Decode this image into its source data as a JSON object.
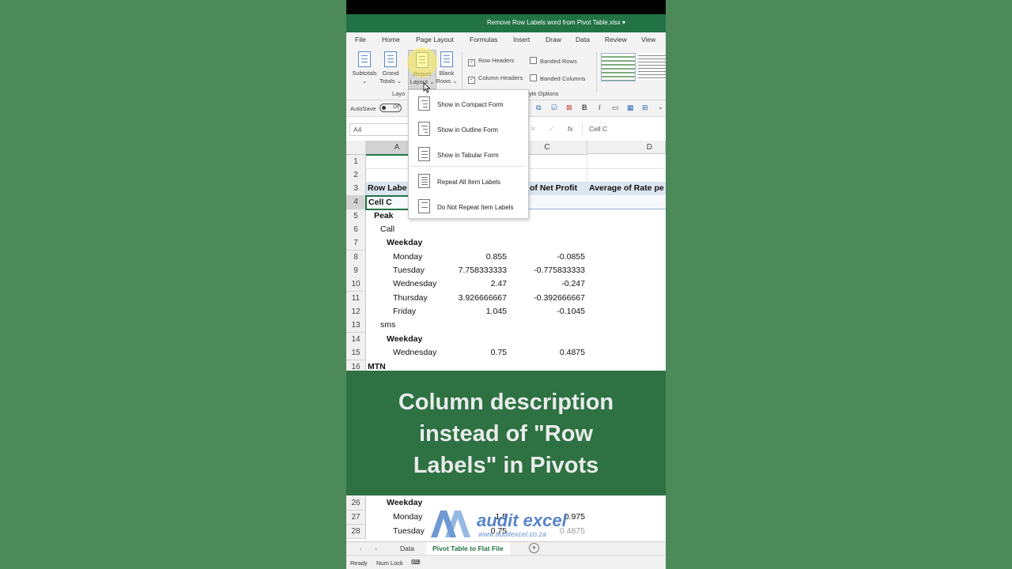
{
  "window": {
    "title": "Remove Row Labels word from Pivot Table.xlsx"
  },
  "menu": [
    "File",
    "Home",
    "Page Layout",
    "Formulas",
    "Insert",
    "Draw",
    "Data",
    "Review",
    "View"
  ],
  "ribbon": {
    "subtotals": "Subtotals",
    "grand_totals": [
      "Grand",
      "Totals"
    ],
    "report_layout": [
      "Report",
      "Layout"
    ],
    "blank_rows": [
      "Blank",
      "Rows"
    ],
    "row_headers": "Row Headers",
    "banded_rows": "Banded Rows",
    "column_headers": "Column Headers",
    "banded_columns": "Banded Columns",
    "group_layout": "Layo",
    "group_style_options": "yle Options"
  },
  "qat": {
    "autosave": "AutoSave",
    "toggle": "Off",
    "bold": "B",
    "italic": "I"
  },
  "formula_bar": {
    "name_box": "A4",
    "fx": "fx",
    "value": "Cell C"
  },
  "columns": [
    "A",
    "C",
    "D"
  ],
  "rows": [
    "1",
    "2",
    "3",
    "4",
    "5",
    "6",
    "7",
    "8",
    "9",
    "10",
    "11",
    "12",
    "13",
    "14",
    "15",
    "16"
  ],
  "cells": {
    "r3a": "Row Labe",
    "r3c": "of Net Profit",
    "r3d": "Average of Rate pe",
    "r4a": "Cell C",
    "r5a": "Peak",
    "r6a": "Call",
    "r7a": "Weekday",
    "r8a": "Monday",
    "r8b": "0.855",
    "r8c": "-0.0855",
    "r9a": "Tuesday",
    "r9b": "7.758333333",
    "r9c": "-0.775833333",
    "r10a": "Wednesday",
    "r10b": "2.47",
    "r10c": "-0.247",
    "r11a": "Thursday",
    "r11b": "3.926666667",
    "r11c": "-0.392666667",
    "r12a": "Friday",
    "r12b": "1.045",
    "r12c": "-0.1045",
    "r13a": "sms",
    "r14a": "Weekday",
    "r15a": "Wednesday",
    "r15b": "0.75",
    "r15c": "0.4875",
    "r16a": "MTN"
  },
  "dropdown": {
    "items": [
      "Show in Compact Form",
      "Show in Outline Form",
      "Show in Tabular Form",
      "Repeat All Item Labels",
      "Do Not Repeat Item Labels"
    ]
  },
  "banner": {
    "text": "Column description\ninstead of \"Row\nLabels\" in Pivots"
  },
  "lower_rows": [
    {
      "num": "26",
      "a": "Weekday",
      "b": "",
      "c": ""
    },
    {
      "num": "27",
      "a": "Monday",
      "b": "1.5",
      "c": "0.975"
    },
    {
      "num": "28",
      "a": "Tuesday",
      "b": "0.75",
      "c": "0.4875"
    }
  ],
  "logo": {
    "name": "audit excel",
    "url": "www.auditexcel.co.za"
  },
  "tabs": [
    "Data",
    "Pivot Table to Flat File"
  ],
  "status": {
    "ready": "Ready",
    "numlock": "Num Lock"
  },
  "colors": {
    "excel_green": "#217346",
    "background": "#4c8a59",
    "banner": "#2e7142",
    "header_fill": "#dce6f1"
  }
}
